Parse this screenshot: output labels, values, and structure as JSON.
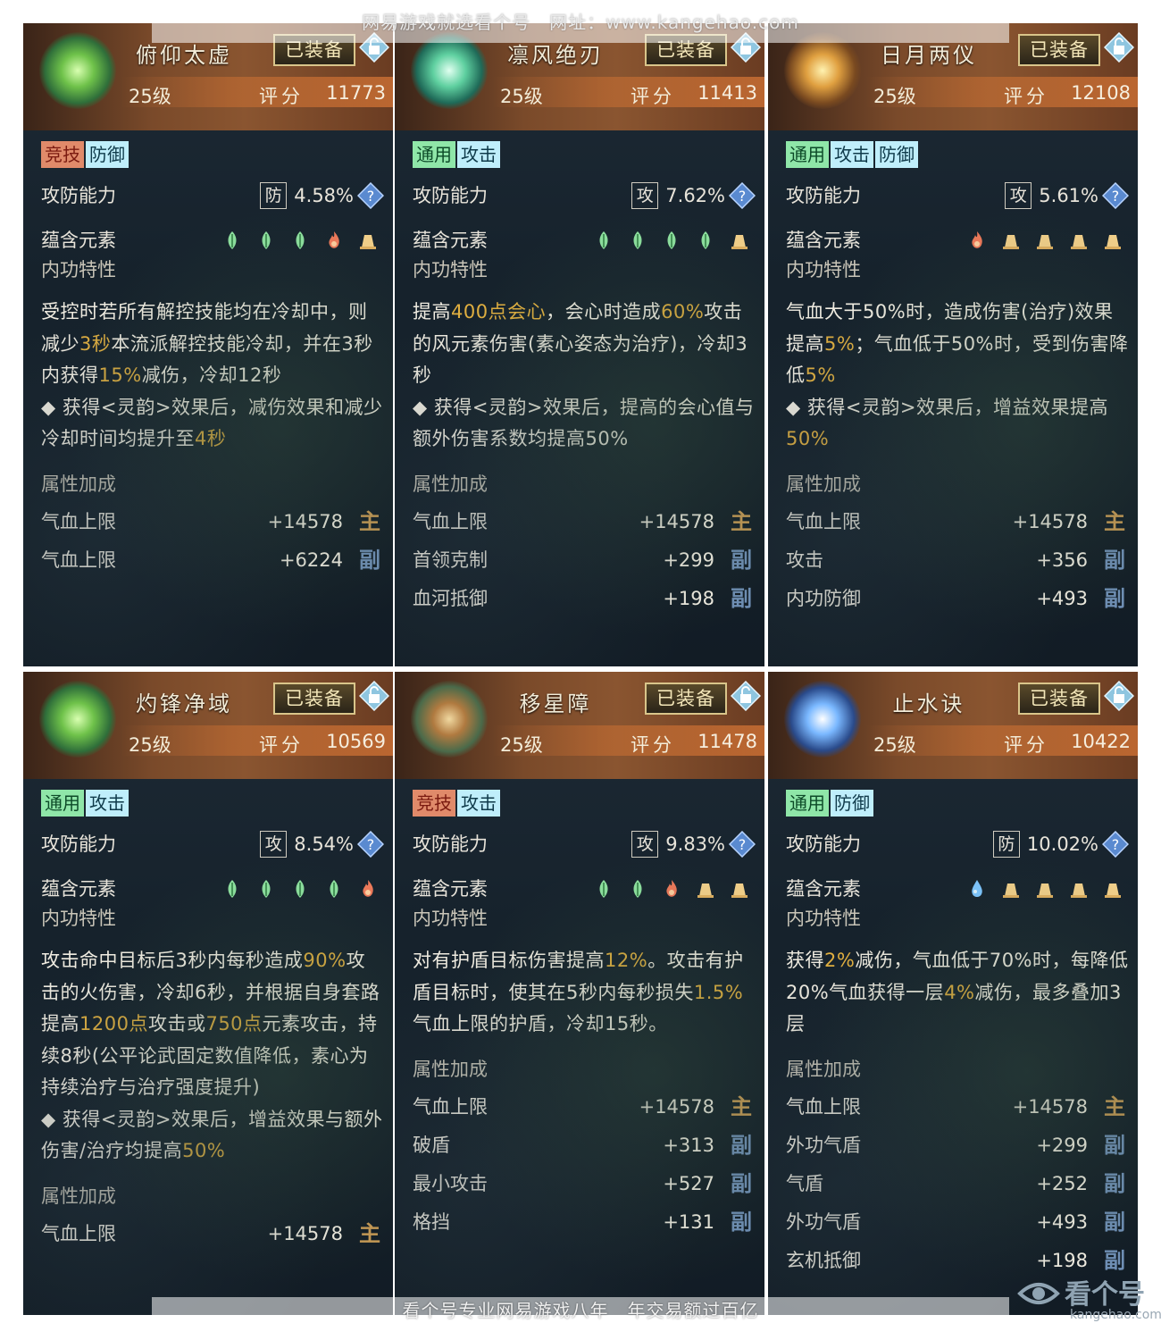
{
  "watermark_top": "网易游戏就选看个号　网址：www.kangehao.com",
  "watermark_bottom": "看个号专业网易游戏八年　年交易额过百亿",
  "brand": {
    "name": "看个号",
    "url": "kangehao.com"
  },
  "labels": {
    "equipped": "已装备",
    "score": "评分",
    "attack_defense": "攻防能力",
    "elements": "蕴含元素",
    "internal": "内功特性",
    "attr_bonus": "属性加成"
  },
  "cards": [
    {
      "name": "俯仰太虚",
      "level": "25级",
      "score": "11773",
      "gem": "green",
      "tags": [
        {
          "text": "竞技",
          "color": "red"
        },
        {
          "text": "防御",
          "color": "cyan"
        }
      ],
      "ad_type": "防",
      "ad_value": "4.58%",
      "elements": [
        "wood",
        "wood",
        "wood",
        "fire",
        "earth"
      ],
      "desc_html": "受控时若所有解控技能均在冷却中，则减少<span class='hl'>3秒</span>本流派解控技能冷却，并在3秒内获得<span class='hl'>15%</span>减伤，冷却12秒<br>◆ 获得&lt;灵韵&gt;效果后，减伤效果和减少冷却时间均提升至<span class='hl'>4秒</span>",
      "attrs": [
        {
          "name": "气血上限",
          "value": "+14578",
          "mark": "主",
          "kind": "main"
        },
        {
          "name": "气血上限",
          "value": "+6224",
          "mark": "副",
          "kind": "sub"
        }
      ]
    },
    {
      "name": "凛风绝刃",
      "level": "25级",
      "score": "11413",
      "gem": "teal",
      "tags": [
        {
          "text": "通用",
          "color": "green"
        },
        {
          "text": "攻击",
          "color": "cyan"
        }
      ],
      "ad_type": "攻",
      "ad_value": "7.62%",
      "elements": [
        "wood",
        "wood",
        "wood",
        "wood",
        "earth"
      ],
      "desc_html": "提高<span class='hl'>400点会心</span>，会心时造成<span class='hl'>60%</span>攻击的风元素伤害(素心姿态为治疗)，冷却3秒<br>◆ 获得&lt;灵韵&gt;效果后，提高的会心值与额外伤害系数均提高50%",
      "attrs": [
        {
          "name": "气血上限",
          "value": "+14578",
          "mark": "主",
          "kind": "main"
        },
        {
          "name": "首领克制",
          "value": "+299",
          "mark": "副",
          "kind": "sub"
        },
        {
          "name": "血河抵御",
          "value": "+198",
          "mark": "副",
          "kind": "sub"
        }
      ]
    },
    {
      "name": "日月两仪",
      "level": "25级",
      "score": "12108",
      "gem": "amber",
      "tags": [
        {
          "text": "通用",
          "color": "green"
        },
        {
          "text": "攻击",
          "color": "cyan"
        },
        {
          "text": "防御",
          "color": "cyan"
        }
      ],
      "ad_type": "攻",
      "ad_value": "5.61%",
      "elements": [
        "fire",
        "earth",
        "earth",
        "earth",
        "earth"
      ],
      "desc_html": "气血大于50%时，造成伤害(治疗)效果提高<span class='hl'>5%</span>；气血低于50%时，受到伤害降低<span class='hl'>5%</span><br>◆ 获得&lt;灵韵&gt;效果后，增益效果提高<span class='hl'>50%</span>",
      "attrs": [
        {
          "name": "气血上限",
          "value": "+14578",
          "mark": "主",
          "kind": "main"
        },
        {
          "name": "攻击",
          "value": "+356",
          "mark": "副",
          "kind": "sub"
        },
        {
          "name": "内功防御",
          "value": "+493",
          "mark": "副",
          "kind": "sub"
        }
      ]
    },
    {
      "name": "灼锋净域",
      "level": "25级",
      "score": "10569",
      "gem": "green",
      "tags": [
        {
          "text": "通用",
          "color": "green"
        },
        {
          "text": "攻击",
          "color": "cyan"
        }
      ],
      "ad_type": "攻",
      "ad_value": "8.54%",
      "elements": [
        "wood",
        "wood",
        "wood",
        "wood",
        "fire"
      ],
      "desc_html": "攻击命中目标后3秒内每秒造成<span class='hl'>90%</span>攻击的火伤害，冷却6秒，并根据自身套路提高<span class='hl'>1200点</span>攻击或<span class='hl'>750点</span>元素攻击，持续8秒(公平论武固定数值降低，素心为持续治疗与治疗强度提升)<br>◆ 获得&lt;灵韵&gt;效果后，增益效果与额外伤害/治疗均提高<span class='hl'>50%</span>",
      "attrs": [
        {
          "name": "气血上限",
          "value": "+14578",
          "mark": "主",
          "kind": "main"
        }
      ]
    },
    {
      "name": "移星障",
      "level": "25级",
      "score": "11478",
      "gem": "bronze",
      "tags": [
        {
          "text": "竞技",
          "color": "red"
        },
        {
          "text": "攻击",
          "color": "cyan"
        }
      ],
      "ad_type": "攻",
      "ad_value": "9.83%",
      "elements": [
        "wood",
        "wood",
        "fire",
        "earth",
        "earth"
      ],
      "desc_html": "对有护盾目标伤害提高<span class='hl'>12%</span>。攻击有护盾目标时，使其在5秒内每秒损失<span class='hl'>1.5%</span>气血上限的护盾，冷却15秒。",
      "attrs": [
        {
          "name": "气血上限",
          "value": "+14578",
          "mark": "主",
          "kind": "main"
        },
        {
          "name": "破盾",
          "value": "+313",
          "mark": "副",
          "kind": "sub"
        },
        {
          "name": "最小攻击",
          "value": "+527",
          "mark": "副",
          "kind": "sub"
        },
        {
          "name": "格挡",
          "value": "+131",
          "mark": "副",
          "kind": "sub"
        }
      ]
    },
    {
      "name": "止水诀",
      "level": "25级",
      "score": "10422",
      "gem": "blue",
      "tags": [
        {
          "text": "通用",
          "color": "green"
        },
        {
          "text": "防御",
          "color": "cyan"
        }
      ],
      "ad_type": "防",
      "ad_value": "10.02%",
      "elements": [
        "water",
        "earth",
        "earth",
        "earth",
        "earth"
      ],
      "desc_html": "获得<span class='hl'>2%</span>减伤，气血低于70%时，每降低20%气血获得一层<span class='hl'>4%</span>减伤，最多叠加3层",
      "attrs": [
        {
          "name": "气血上限",
          "value": "+14578",
          "mark": "主",
          "kind": "main"
        },
        {
          "name": "外功气盾",
          "value": "+299",
          "mark": "副",
          "kind": "sub"
        },
        {
          "name": "气盾",
          "value": "+252",
          "mark": "副",
          "kind": "sub"
        },
        {
          "name": "外功气盾",
          "value": "+493",
          "mark": "副",
          "kind": "sub"
        },
        {
          "name": "玄机抵御",
          "value": "+198",
          "mark": "副",
          "kind": "sub"
        }
      ]
    }
  ]
}
